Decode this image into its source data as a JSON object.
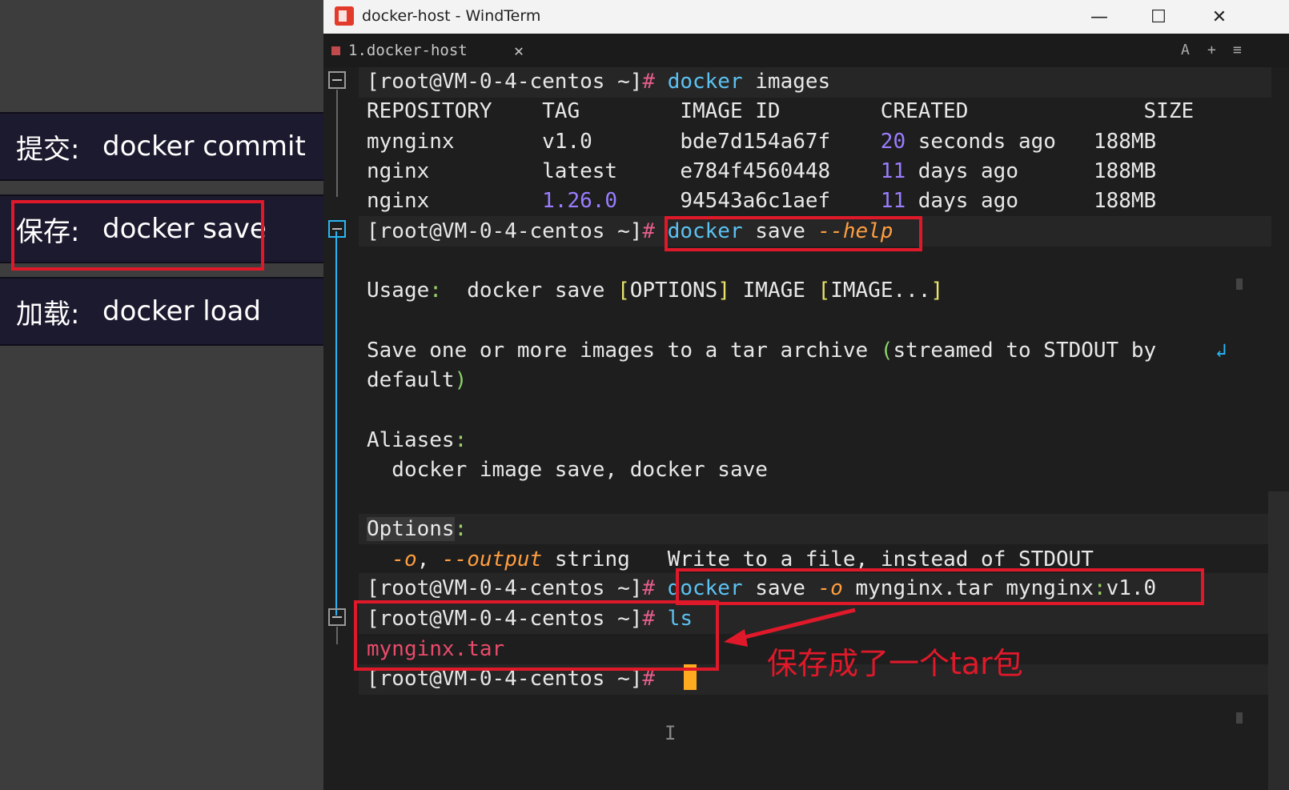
{
  "slide": {
    "cards": [
      {
        "key": "提交:",
        "value": "docker commit"
      },
      {
        "key": "保存:",
        "value": "docker save"
      },
      {
        "key": "加载:",
        "value": "docker load"
      }
    ]
  },
  "window": {
    "title": "docker-host - WindTerm",
    "minimize": "—",
    "maximize": "☐",
    "close": "✕"
  },
  "tab": {
    "label": "1.docker-host",
    "close": "✕",
    "right_icons": [
      "A",
      "+",
      "≡"
    ]
  },
  "terminal": {
    "prompt": "[root@VM-0-4-centos ~]",
    "hash": "#",
    "cmd1": {
      "docker": "docker",
      "rest": " images"
    },
    "table_header": "REPOSITORY    TAG        IMAGE ID        CREATED              SIZE",
    "rows": [
      {
        "repo": "mynginx       ",
        "tag": "v1.0       ",
        "id": "bde7d154a67f    ",
        "num": "20",
        "rest": " seconds ago   ",
        "size": "188MB"
      },
      {
        "repo": "nginx         ",
        "tag": "latest     ",
        "id": "e784f4560448    ",
        "num": "11",
        "rest": " days ago      ",
        "size": "188MB"
      },
      {
        "repo": "nginx         ",
        "tag_num": "1.26.0",
        "tag_pad": "     ",
        "id": "94543a6c1aef    ",
        "num": "11",
        "rest": " days ago      ",
        "size": "188MB"
      }
    ],
    "cmd2": {
      "docker": "docker",
      "save": " save ",
      "opt": "--help"
    },
    "usage": {
      "label": "Usage",
      "colon": ":",
      "cmd": "  docker save ",
      "lb1": "[",
      "opts": "OPTIONS",
      "rb1": "]",
      "img": " IMAGE ",
      "lb2": "[",
      "imgs": "IMAGE...",
      "rb2": "]"
    },
    "desc1_a": "Save one or more images to a tar archive ",
    "desc1_p": "(",
    "desc1_b": "streamed to STDOUT by ",
    "wrap_icon": "↲",
    "desc2_a": "default",
    "desc2_p": ")",
    "aliases_label": "Aliases",
    "aliases_colon": ":",
    "aliases_value": "  docker image save, docker save",
    "options_label": "Options",
    "options_colon": ":",
    "opt_line": {
      "indent": "  ",
      "short": "-o",
      "sep": ", ",
      "long": "--output",
      "type": " string   ",
      "desc": "Write to a file, instead of STDOUT"
    },
    "cmd3": {
      "docker": "docker",
      "save": " save ",
      "opt": "-o",
      "args": " mynginx.tar mynginx",
      "colon": ":",
      "tag": "v1.0"
    },
    "cmd4": {
      "cmd": " ls"
    },
    "ls_output": "mynginx.tar"
  },
  "annotation": "保存成了一个tar包",
  "colors": {
    "highlight_red": "#e0192a",
    "prompt_hash": "#e35d8a",
    "command_blue": "#5cc2f2",
    "option_orange": "#ff9e40",
    "cursor": "#ffab1f"
  }
}
